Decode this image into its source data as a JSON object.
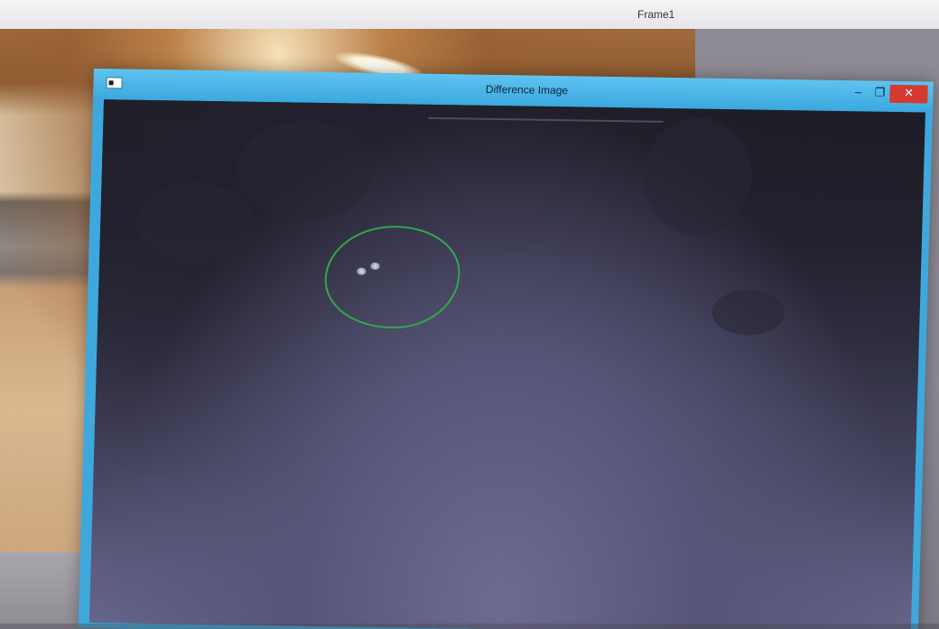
{
  "back_window": {
    "title": "Frame1"
  },
  "front_window": {
    "title": "Difference Image",
    "controls": {
      "minimize_glyph": "‒",
      "maximize_glyph": "❐",
      "close_glyph": "✕"
    }
  },
  "colors": {
    "titlebar_accent": "#3ea8dc",
    "close_button": "#d43a2f",
    "annotation_stroke": "#2fa84b",
    "canvas_dark": "#1e1d27"
  },
  "icons": {
    "window_system_icon": "app-window-icon",
    "minimize": "minimize-icon",
    "maximize": "maximize-icon",
    "close": "close-icon"
  }
}
